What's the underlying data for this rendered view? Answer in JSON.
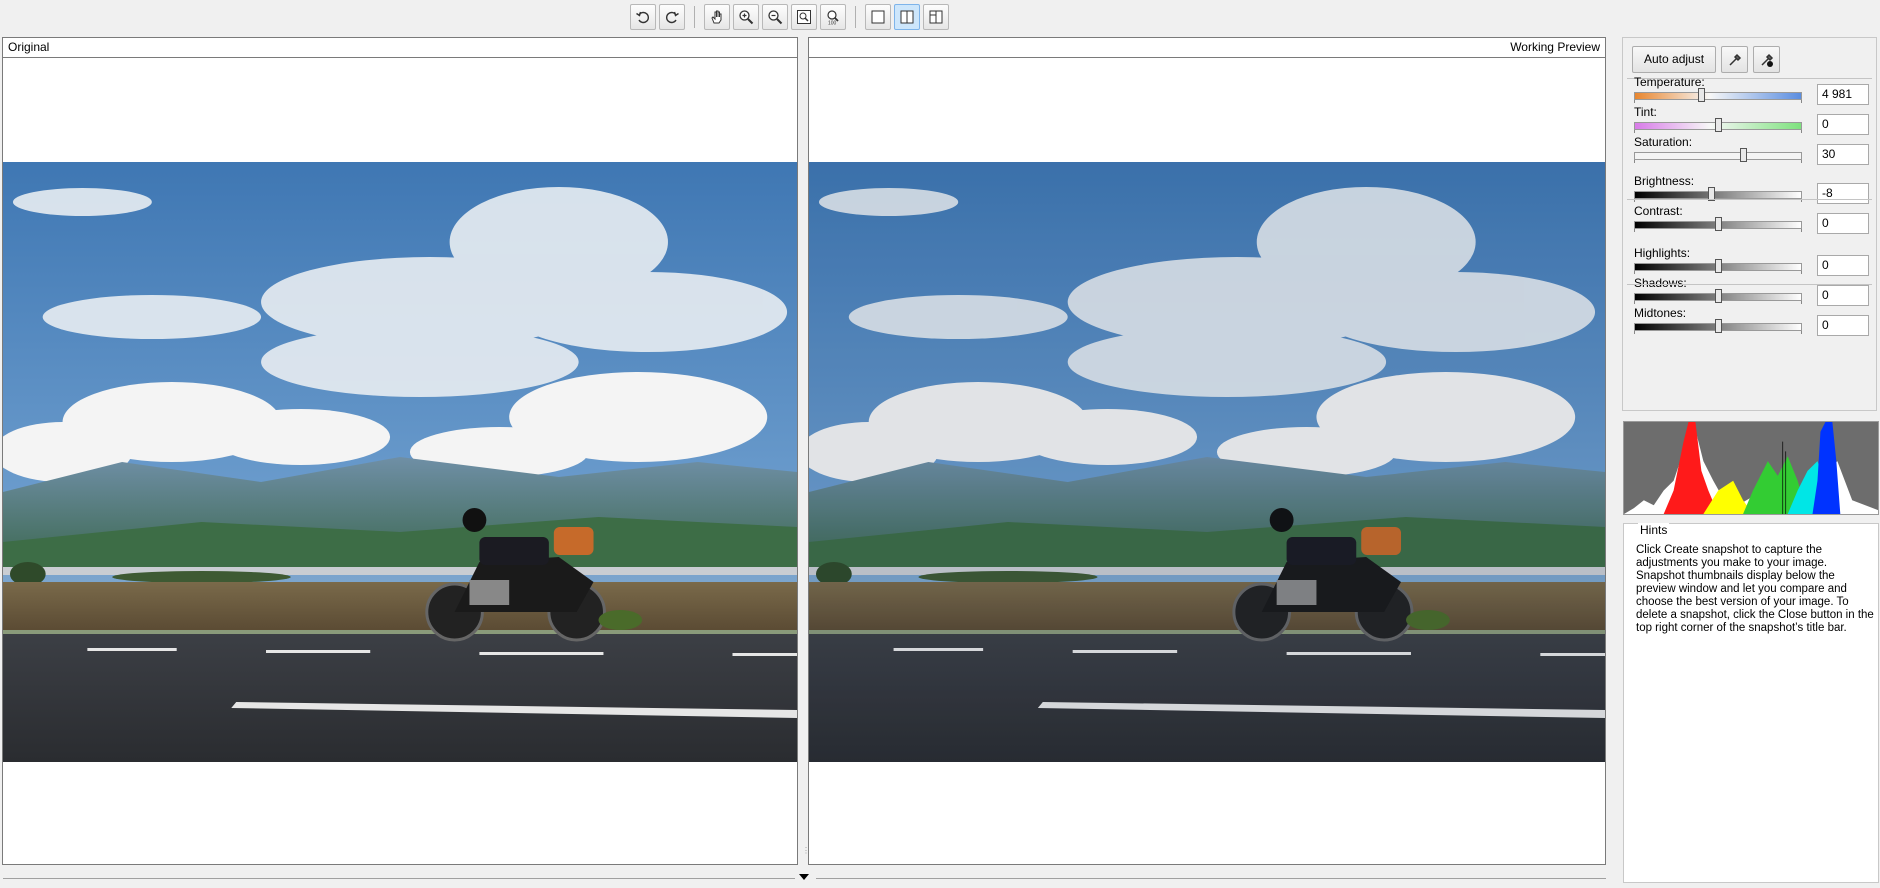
{
  "toolbar": {
    "buttons": [
      {
        "name": "rotate-left",
        "icon": "rotate-ccw-icon"
      },
      {
        "name": "rotate-right",
        "icon": "rotate-cw-icon"
      },
      {
        "name": "pan",
        "icon": "hand-icon"
      },
      {
        "name": "zoom-in",
        "icon": "zoom-in-icon"
      },
      {
        "name": "zoom-out",
        "icon": "zoom-out-icon"
      },
      {
        "name": "fit-window",
        "icon": "fit-icon"
      },
      {
        "name": "actual-size",
        "icon": "zoom-100-icon",
        "label": "100"
      },
      {
        "name": "single-view",
        "icon": "single-pane-icon"
      },
      {
        "name": "split-view",
        "icon": "split-pane-icon",
        "active": true
      },
      {
        "name": "split-vertical-view",
        "icon": "split-vertical-icon"
      }
    ],
    "zoom100_label": "100"
  },
  "panes": {
    "left_title": "Original",
    "right_title": "Working Preview"
  },
  "adjust": {
    "auto_adjust_label": "Auto adjust",
    "tools": [
      "eyedropper-icon",
      "eyedropper-fill-icon"
    ],
    "sliders": [
      {
        "label": "Temperature:",
        "value": "4 981",
        "pos": 0.4,
        "kind": "temp"
      },
      {
        "label": "Tint:",
        "value": "0",
        "pos": 0.5,
        "kind": "tint"
      },
      {
        "label": "Saturation:",
        "value": "30",
        "pos": 0.65,
        "kind": "plain"
      },
      {
        "label": "Brightness:",
        "value": "-8",
        "pos": 0.46,
        "kind": "gray"
      },
      {
        "label": "Contrast:",
        "value": "0",
        "pos": 0.5,
        "kind": "gray"
      },
      {
        "label": "Highlights:",
        "value": "0",
        "pos": 0.5,
        "kind": "gray"
      },
      {
        "label": "Shadows:",
        "value": "0",
        "pos": 0.5,
        "kind": "gray"
      },
      {
        "label": "Midtones:",
        "value": "0",
        "pos": 0.5,
        "kind": "gray"
      }
    ]
  },
  "hints": {
    "title": "Hints",
    "text": "Click Create snapshot to capture the adjustments you make to your image. Snapshot thumbnails display below the preview window and let you compare and choose the best version of your image. To delete a snapshot, click the Close button in the top right corner of the snapshot’s title bar."
  },
  "colors": {
    "accent": "#7eb4ea",
    "histogram_bg": "#6d6d6d"
  }
}
